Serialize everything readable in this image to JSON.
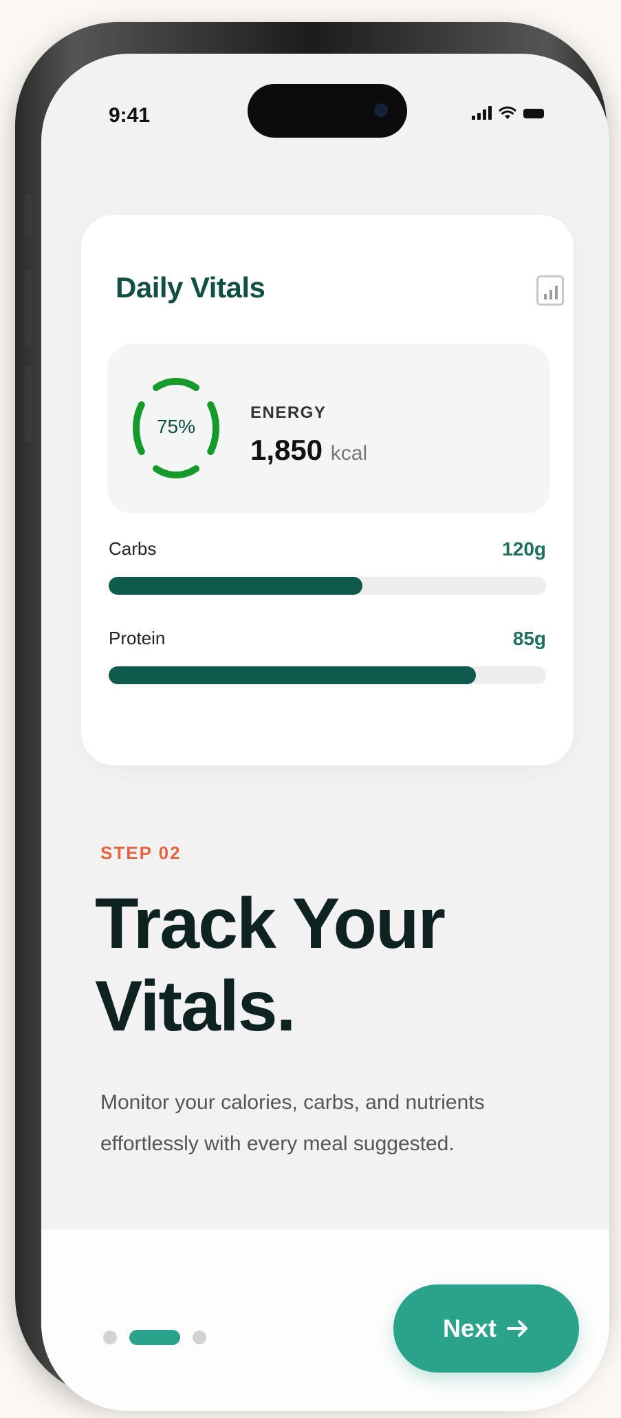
{
  "status_bar": {
    "time": "9:41",
    "icons": [
      "signal-icon",
      "wifi-icon",
      "battery-icon"
    ]
  },
  "card": {
    "title": "Daily Vitals",
    "action_icon": "bar-chart-icon",
    "energy": {
      "percent_label": "75%",
      "progress": 0.75,
      "label": "ENERGY",
      "value": "1,850",
      "unit": "kcal"
    },
    "macros": [
      {
        "label": "Carbs",
        "value": "120g",
        "progress": 0.58
      },
      {
        "label": "Protein",
        "value": "85g",
        "progress": 0.84
      }
    ]
  },
  "onboarding": {
    "step": "STEP 02",
    "headline_line1": "Track Your",
    "headline_line2": "Vitals.",
    "description": "Monitor your calories, carbs, and nutrients effortlessly with every meal suggested."
  },
  "pagination": {
    "total": 3,
    "active_index": 1
  },
  "next_button": {
    "label": "Next",
    "icon": "arrow-right-icon"
  },
  "colors": {
    "brand": "#124f43",
    "accent": "#2aa28c",
    "ring": "#179a2c",
    "step": "#e8623d"
  }
}
